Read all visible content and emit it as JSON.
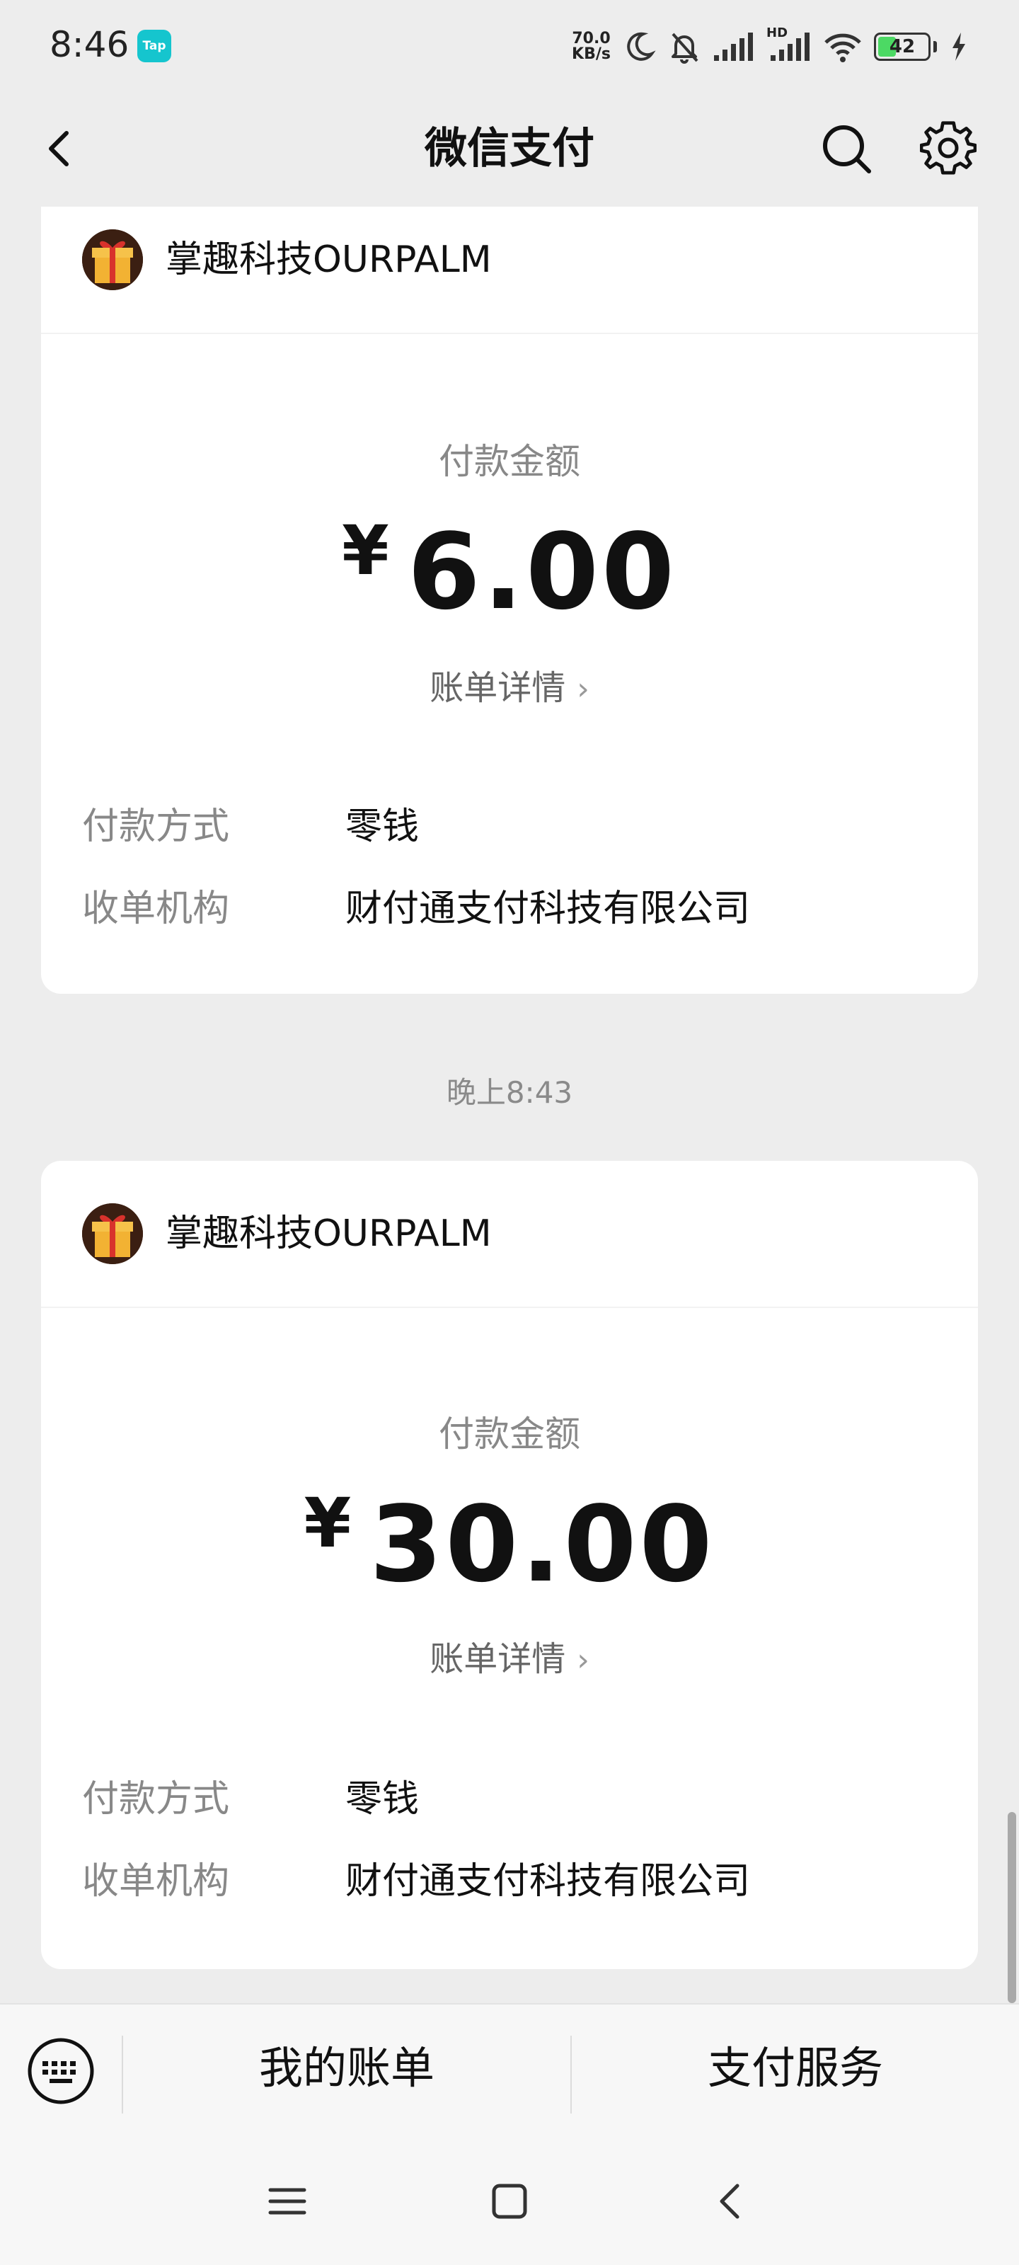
{
  "status_bar": {
    "time": "8:46",
    "app_badge": "Tap",
    "net_speed_value": "70.0",
    "net_speed_unit": "KB/s",
    "hd_label": "HD",
    "battery_level": "42"
  },
  "nav": {
    "title": "微信支付"
  },
  "transactions": [
    {
      "merchant": "掌趣科技OURPALM",
      "amount_label": "付款金额",
      "currency": "¥",
      "amount": "6.00",
      "bill_detail": "账单详情",
      "payment_method_label": "付款方式",
      "payment_method": "零钱",
      "acquirer_label": "收单机构",
      "acquirer": "财付通支付科技有限公司"
    },
    {
      "timestamp": "晚上8:43",
      "merchant": "掌趣科技OURPALM",
      "amount_label": "付款金额",
      "currency": "¥",
      "amount": "30.00",
      "bill_detail": "账单详情",
      "payment_method_label": "付款方式",
      "payment_method": "零钱",
      "acquirer_label": "收单机构",
      "acquirer": "财付通支付科技有限公司"
    }
  ],
  "bottom_bar": {
    "my_bills": "我的账单",
    "pay_services": "支付服务"
  },
  "colors": {
    "background": "#ededed",
    "card": "#ffffff",
    "muted_text": "#888888",
    "battery_fill": "#4cd964",
    "app_badge": "#15c5ce"
  },
  "icons": [
    "back-icon",
    "search-icon",
    "gear-icon",
    "keyboard-icon",
    "menu-icon",
    "home-icon",
    "nav-back-icon"
  ]
}
